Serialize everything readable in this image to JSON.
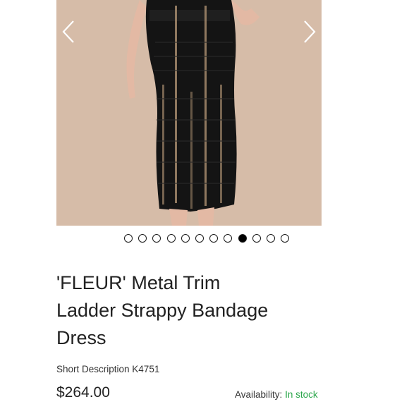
{
  "product": {
    "title_lines": [
      "'FLEUR' Metal Trim",
      "Ladder Strappy Bandage",
      "Dress"
    ],
    "short_description": "Short Description K4751",
    "price": "$264.00",
    "availability_label": "Availability:",
    "availability_value": "In stock",
    "stock_color": "#2aa64a"
  },
  "gallery": {
    "image_alt": "Black metal trim ladder strappy bandage dress",
    "background_color": "#d9bfab",
    "dress_color": "#141414",
    "prev_icon": "chevron-left-icon",
    "next_icon": "chevron-right-icon",
    "dots_total": 12,
    "active_dot_index": 8
  }
}
